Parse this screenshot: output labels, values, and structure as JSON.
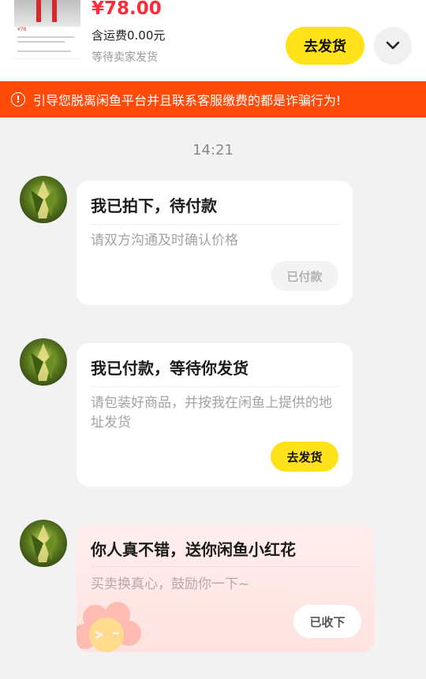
{
  "order": {
    "price": "¥78.00",
    "shipping": "含运费0.00元",
    "status": "等待卖家发货",
    "ship_button": "去发货",
    "thumbnail_price": "¥78"
  },
  "warning": {
    "icon": "warning-icon",
    "text": "引导您脱离闲鱼平台并且联系客服缴费的都是诈骗行为!"
  },
  "timestamp": "14:21",
  "messages": [
    {
      "title": "我已拍下，待付款",
      "desc": "请双方沟通及时确认价格",
      "button": "已付款"
    },
    {
      "title": "我已付款，等待你发货",
      "desc": "请包装好商品，并按我在闲鱼上提供的地址发货",
      "button": "去发货"
    },
    {
      "title": "你人真不错，送你闲鱼小红花",
      "desc": "买卖换真心，鼓励你一下~",
      "button": "已收下"
    }
  ],
  "colors": {
    "accent_yellow": "#ffe21a",
    "price_red": "#ff2a3a",
    "warning_orange": "#ff4a0a"
  }
}
